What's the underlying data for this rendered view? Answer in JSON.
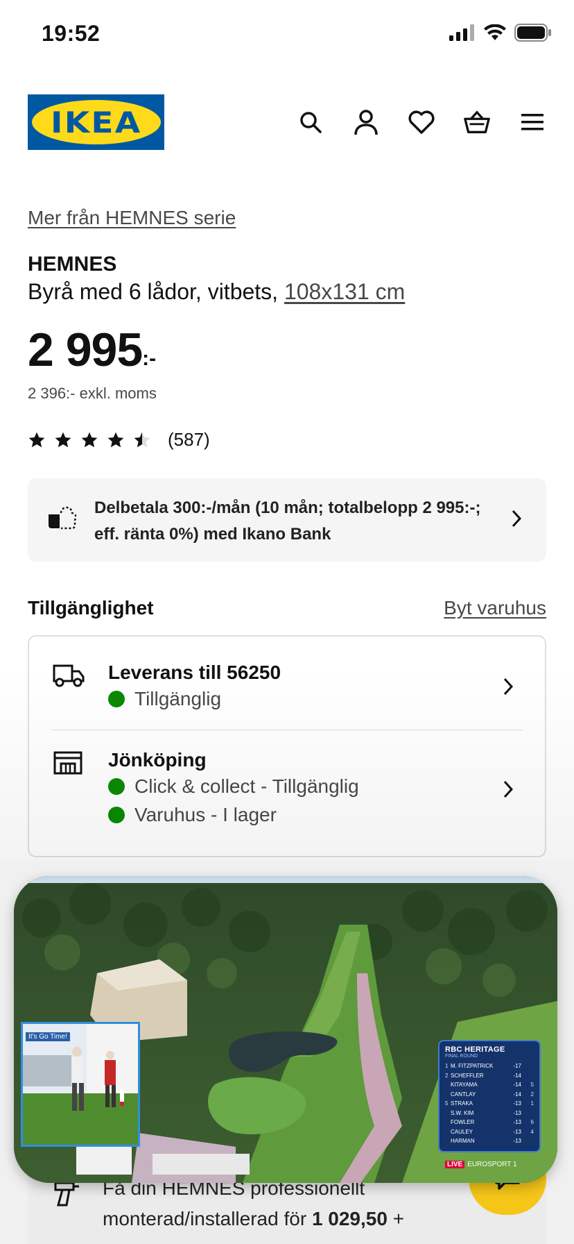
{
  "status_bar": {
    "time": "19:52"
  },
  "header": {
    "logo_text": "IKEA",
    "icons": [
      "search-icon",
      "account-icon",
      "wishlist-heart-icon",
      "shopping-basket-icon",
      "hamburger-menu-icon"
    ]
  },
  "product": {
    "series_link": "Mer från HEMNES serie",
    "name": "HEMNES",
    "description": "Byrå med 6 lådor, vitbets,",
    "dimensions": "108x131 cm",
    "price": "2 995",
    "price_suffix": ":-",
    "price_ex_vat": "2 396:- exkl. moms",
    "rating_stars": 4.5,
    "rating_count": "(587)"
  },
  "installment": {
    "text": "Delbetala 300:-/mån (10 mån; totalbelopp 2 995:-; eff. ränta 0%) med Ikano Bank"
  },
  "availability": {
    "title": "Tillgänglighet",
    "change_store": "Byt varuhus",
    "delivery": {
      "title": "Leverans till 56250",
      "status": "Tillgänglig"
    },
    "store": {
      "title": "Jönköping",
      "click_collect": "Click & collect - Tillgänglig",
      "in_store": "Varuhus - I lager"
    }
  },
  "assembly": {
    "text_prefix": "Få din HEMNES professionellt monterad/installerad för",
    "price": "1 029,50",
    "text_suffix": "+"
  },
  "video_pip": {
    "inset_banner": "It's Go Time!",
    "scoreboard": {
      "title": "RBC HERITAGE",
      "subtitle": "FINAL ROUND",
      "rows": [
        {
          "pos": "1",
          "name": "M. FITZPATRICK",
          "score": "-17",
          "move": ""
        },
        {
          "pos": "2",
          "name": "SCHEFFLER",
          "score": "-14",
          "move": ""
        },
        {
          "pos": "",
          "name": "KITAYAMA",
          "score": "-14",
          "move": "5"
        },
        {
          "pos": "",
          "name": "CANTLAY",
          "score": "-14",
          "move": "2"
        },
        {
          "pos": "5",
          "name": "STRAKA",
          "score": "-13",
          "move": "1"
        },
        {
          "pos": "",
          "name": "S.W. KIM",
          "score": "-13",
          "move": ""
        },
        {
          "pos": "",
          "name": "FOWLER",
          "score": "-13",
          "move": "6"
        },
        {
          "pos": "",
          "name": "CAULEY",
          "score": "-13",
          "move": "4"
        },
        {
          "pos": "",
          "name": "HARMAN",
          "score": "-13",
          "move": ""
        }
      ]
    },
    "live_label": "LIVE",
    "channel": "EUROSPORT 1"
  },
  "colors": {
    "ikea_blue": "#0058a3",
    "ikea_yellow": "#ffda1a",
    "available_green": "#0a8a00",
    "chat_button": "#f5c518"
  }
}
